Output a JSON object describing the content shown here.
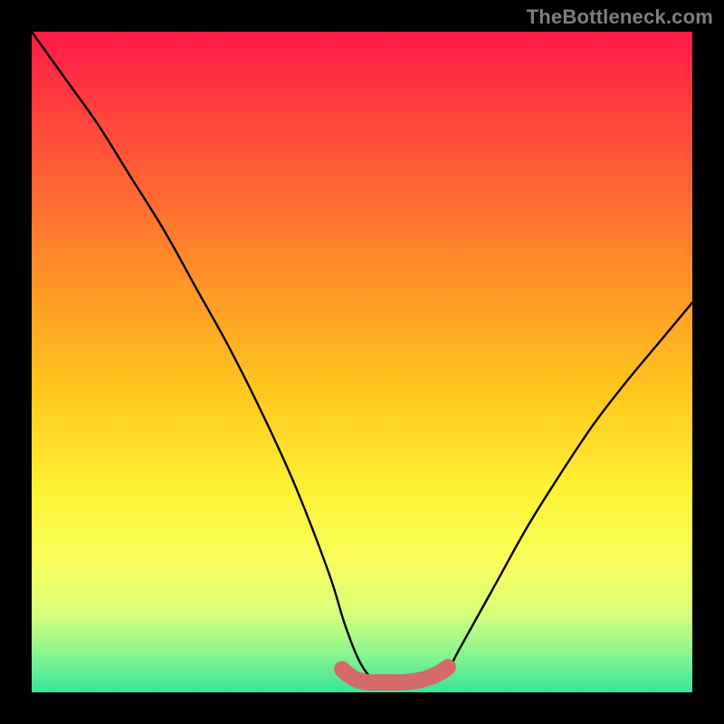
{
  "watermark": "TheBottleneck.com",
  "chart_data": {
    "type": "line",
    "title": "",
    "xlabel": "",
    "ylabel": "",
    "xlim": [
      0,
      100
    ],
    "ylim": [
      0,
      100
    ],
    "series": [
      {
        "name": "bottleneck-curve",
        "x": [
          0,
          5,
          10,
          15,
          20,
          25,
          30,
          35,
          40,
          45,
          47.5,
          50,
          52.5,
          55,
          57.5,
          60,
          62.5,
          65,
          70,
          75,
          80,
          85,
          90,
          95,
          100
        ],
        "values": [
          100,
          93,
          86,
          78,
          70,
          61,
          52,
          42,
          31,
          18,
          10,
          4,
          1.5,
          1.5,
          1.5,
          1.8,
          2.7,
          7,
          16,
          25,
          33,
          40.5,
          47,
          53,
          59
        ]
      },
      {
        "name": "flat-highlight",
        "x": [
          47,
          48,
          49,
          50,
          51,
          52,
          53,
          54,
          55,
          56,
          57,
          58,
          59,
          60,
          61,
          62,
          63
        ],
        "values": [
          3.5,
          2.6,
          2.0,
          1.7,
          1.5,
          1.5,
          1.5,
          1.5,
          1.5,
          1.5,
          1.6,
          1.7,
          1.9,
          2.2,
          2.6,
          3.1,
          3.8
        ]
      }
    ],
    "colors": {
      "curve": "#000000",
      "highlight": "#d46a6a",
      "bg_top": "#ff1a46",
      "bg_bottom": "#37e49c"
    }
  }
}
